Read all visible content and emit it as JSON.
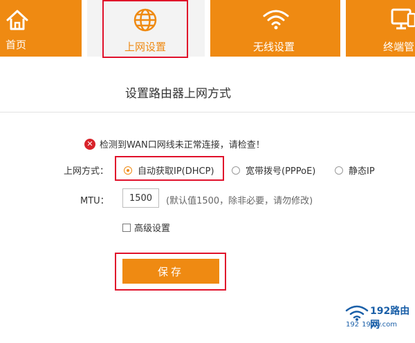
{
  "nav": {
    "tabs": [
      {
        "label": "首页",
        "icon": "home-icon"
      },
      {
        "label": "上网设置",
        "icon": "globe-icon"
      },
      {
        "label": "无线设置",
        "icon": "wifi-icon"
      },
      {
        "label": "终端管",
        "icon": "monitor-icon"
      }
    ],
    "active_index": 1
  },
  "page": {
    "title": "设置路由器上网方式"
  },
  "warning": {
    "text": "检测到WAN口网线未正常连接，请检查！"
  },
  "form": {
    "connection_label": "上网方式：",
    "options": [
      {
        "label": "自动获取IP(DHCP)",
        "checked": true
      },
      {
        "label": "宽带拨号(PPPoE)",
        "checked": false
      },
      {
        "label": "静态IP",
        "checked": false
      }
    ],
    "mtu_label": "MTU：",
    "mtu_value": "1500",
    "mtu_hint": "(默认值1500，除非必要，请勿修改)",
    "advanced_label": "高级设置",
    "save_label": "保存"
  },
  "watermark": {
    "brand": "192路由网",
    "url_left": "192",
    "url_right": "192ly.com"
  },
  "colors": {
    "accent": "#ef8a12",
    "highlight_box": "#e0102a",
    "error": "#d8232a",
    "watermark": "#1a5fa8"
  }
}
